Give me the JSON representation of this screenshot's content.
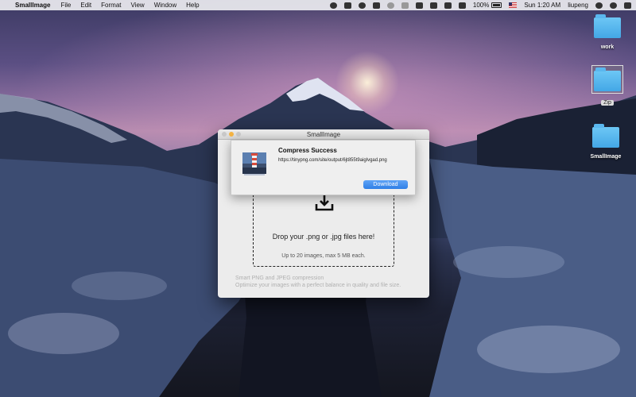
{
  "menubar": {
    "apple_glyph": "",
    "app_name": "SmallImage",
    "menus": [
      "File",
      "Edit",
      "Format",
      "View",
      "Window",
      "Help"
    ],
    "battery_percent_text": "100%",
    "battery_level": 1.0,
    "clock": "Sun 1:20 AM",
    "username": "liupeng",
    "tray_icons": [
      "penguin-icon",
      "cloud-icon",
      "wechat-icon",
      "dropbox-icon",
      "time-machine-icon",
      "bluetooth-icon",
      "volume-icon",
      "wifi-icon",
      "airplay-icon",
      "mute-icon",
      "battery-icon",
      "flag-icon",
      "search-icon",
      "siri-icon",
      "list-icon"
    ]
  },
  "desktop": {
    "icons": [
      {
        "label": "work",
        "icon": "folder-icon"
      },
      {
        "label": "Zip",
        "icon": "folder-icon",
        "selected": true
      },
      {
        "label": "SmallImage",
        "icon": "folder-icon"
      }
    ]
  },
  "window": {
    "title": "SmallImage",
    "drop_title": "Drop your .png or .jpg files here!",
    "drop_subtitle": "Up to 20 images, max 5 MB each.",
    "footer_line1": "Smart PNG and JPEG compression",
    "footer_line2": "Optimize your images with a perfect balance in quality and file size."
  },
  "notification": {
    "title": "Compress Success",
    "url": "https://tinypng.com/site/output/6jt855t9aiglvgad.png",
    "button_label": "Download",
    "icon": "lighthouse-app-icon"
  },
  "colors": {
    "accent_blue": "#2f7fe6",
    "folder_blue": "#4fb3ea",
    "minimize_yellow": "#f5b443"
  }
}
